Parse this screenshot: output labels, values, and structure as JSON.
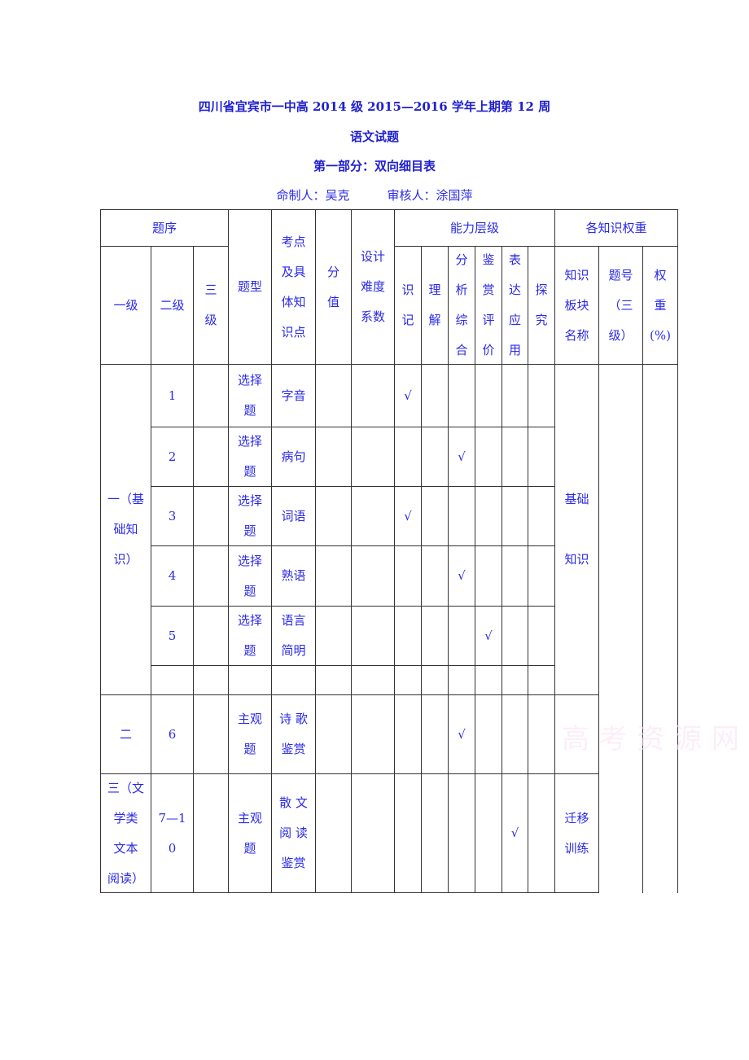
{
  "document": {
    "title_line1": "四川省宜宾市一中高 2014 级 2015—2016 学年上期第 12 周",
    "title_line2": "语文试题",
    "title_line3": "第一部分：双向细目表",
    "author_label": "命制人：吴克",
    "reviewer_label": "审核人：涂国萍",
    "watermark": "高考资源网"
  },
  "table": {
    "headers": {
      "question_order": "题序",
      "level1": "一级",
      "level2": "二级",
      "level3": "三\n级",
      "question_type": "题型",
      "knowledge_point": "考点\n及具\n体知\n识点",
      "score": "分\n值",
      "difficulty": "设计\n难度\n系数",
      "ability_level": "能力层级",
      "ability_cols": [
        "识\n记",
        "理\n解",
        "分\n析\n综\n合",
        "鉴\n赏\n评\n价",
        "表\n达\n应\n用",
        "探\n究"
      ],
      "knowledge_weight": "各知识权重",
      "block_name": "知识\n板块\n名称",
      "question_no": "题号\n（三\n级）",
      "weight": "权\n重\n(%)"
    },
    "check_mark": "√",
    "groups": [
      {
        "level1": "一（基\n础知\n识）",
        "block": "基础\n\n知识"
      },
      {
        "level1": "二",
        "block": ""
      },
      {
        "level1": "三（文\n学类\n文本\n阅读）",
        "block": "迁移\n训练"
      }
    ],
    "rows": [
      {
        "level2": "1",
        "level3": "",
        "type": "选择\n题",
        "point": "字音",
        "score": "",
        "difficulty": "",
        "ability_index": 0
      },
      {
        "level2": "2",
        "level3": "",
        "type": "选择\n题",
        "point": "病句",
        "score": "",
        "difficulty": "",
        "ability_index": 2
      },
      {
        "level2": "3",
        "level3": "",
        "type": "选择\n题",
        "point": "词语",
        "score": "",
        "difficulty": "",
        "ability_index": 0
      },
      {
        "level2": "4",
        "level3": "",
        "type": "选择\n题",
        "point": "熟语",
        "score": "",
        "difficulty": "",
        "ability_index": 2
      },
      {
        "level2": "5",
        "level3": "",
        "type": "选择\n题",
        "point": "语言\n简明",
        "score": "",
        "difficulty": "",
        "ability_index": 3
      },
      {
        "level2": "",
        "level3": "",
        "type": "",
        "point": "",
        "score": "",
        "difficulty": "",
        "ability_index": -1
      },
      {
        "level2": "6",
        "level3": "",
        "type": "主观\n题",
        "point": "诗 歌\n鉴赏",
        "score": "",
        "difficulty": "",
        "ability_index": 2
      },
      {
        "level2": "7—1\n0",
        "level3": "",
        "type": "主观\n题",
        "point": "散 文\n阅 读\n鉴赏",
        "score": "",
        "difficulty": "",
        "ability_index": 4
      }
    ]
  }
}
